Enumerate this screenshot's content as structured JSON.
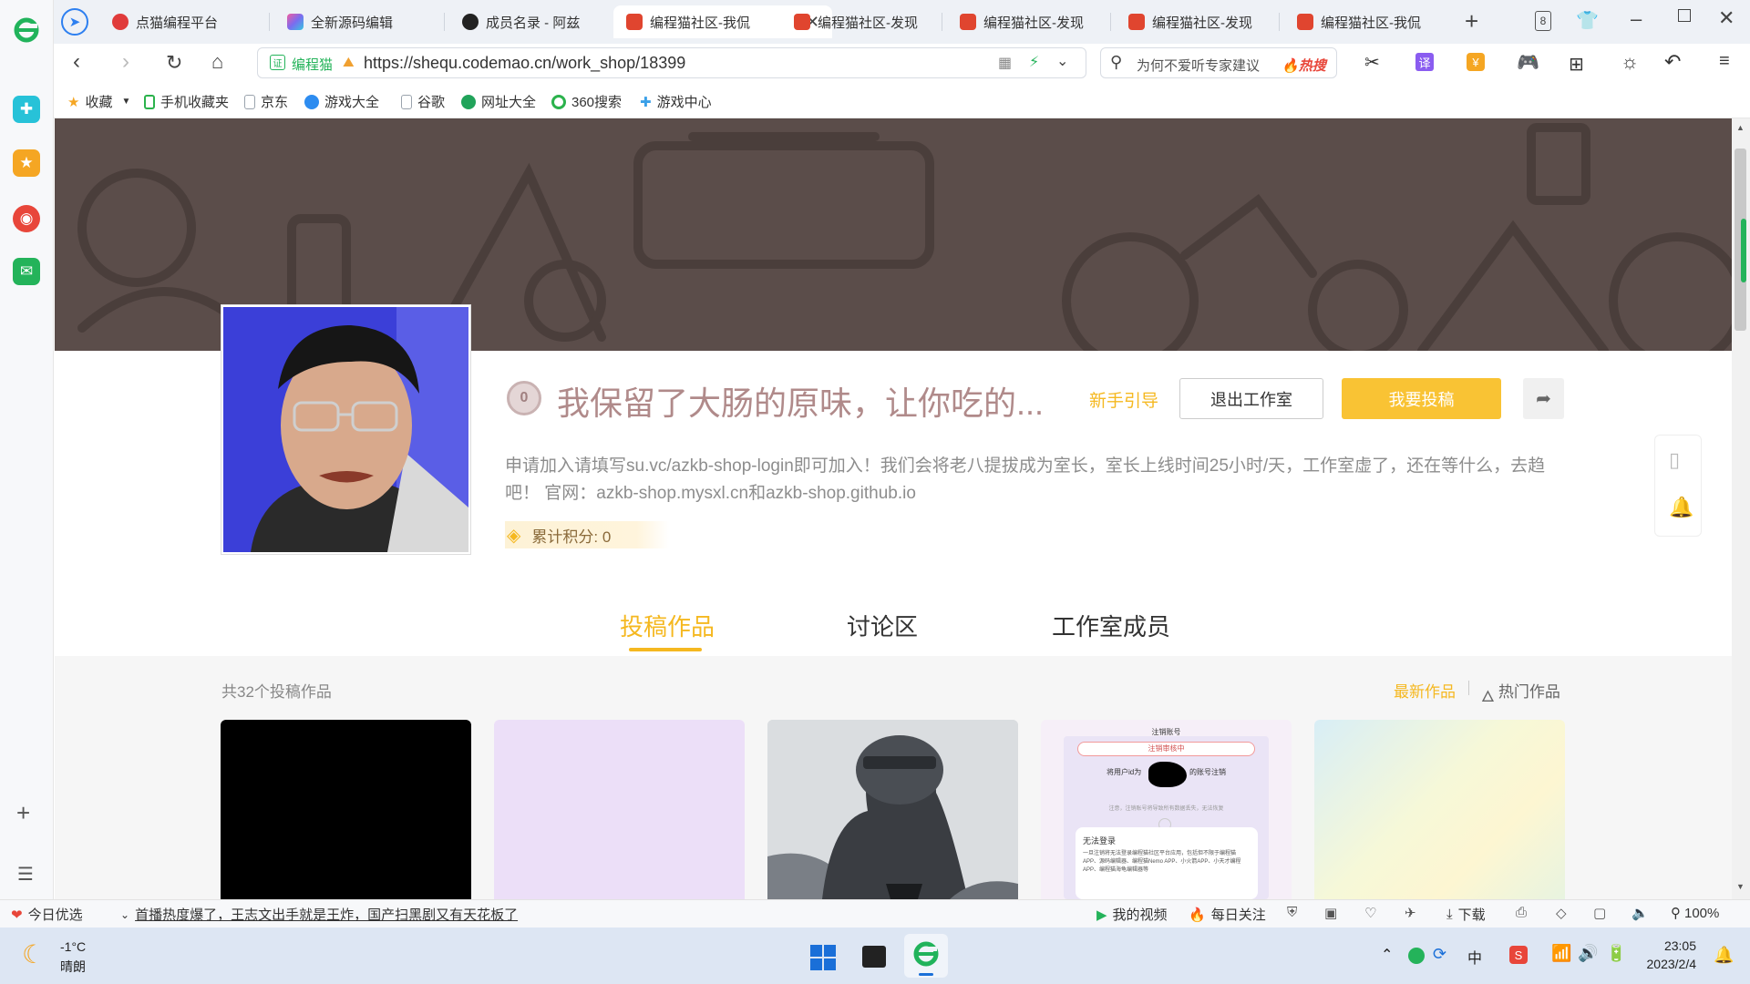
{
  "browser": {
    "tabs": [
      {
        "label": "点猫编程平台",
        "color": "#e03b3b"
      },
      {
        "label": "全新源码编辑",
        "color": "#7a6cf0"
      },
      {
        "label": "成员名录 - 阿兹",
        "color": "#222222"
      },
      {
        "label": "编程猫社区-我侃",
        "color": "#e0452f"
      },
      {
        "label": "编程猫社区-发现",
        "color": "#e0452f"
      },
      {
        "label": "编程猫社区-发现",
        "color": "#e0452f"
      },
      {
        "label": "编程猫社区-发现",
        "color": "#e0452f"
      },
      {
        "label": "编程猫社区-我侃",
        "color": "#e0452f"
      }
    ],
    "tab_count": "8",
    "site_badge": "编程猫",
    "url": "https://shequ.codemao.cn/work_shop/18399",
    "search_placeholder": "为何不爱听专家建议",
    "hot_label": "热搜",
    "translate_label": "译",
    "bookmarks": [
      {
        "label": "收藏",
        "color": "#f5a623"
      },
      {
        "label": "手机收藏夹",
        "color": "#2bb24c"
      },
      {
        "label": "京东",
        "color": "#9aa3ad"
      },
      {
        "label": "游戏大全",
        "color": "#2d8cf0"
      },
      {
        "label": "谷歌",
        "color": "#9aa3ad"
      },
      {
        "label": "网址大全",
        "color": "#21a35a"
      },
      {
        "label": "360搜索",
        "color": "#2bb24c"
      },
      {
        "label": "游戏中心",
        "color": "#3aa0e8"
      }
    ]
  },
  "studio": {
    "level_badge": "0",
    "name": "我保留了大肠的原味，让你吃的...",
    "guide_link": "新手引导",
    "leave_button": "退出工作室",
    "submit_button": "我要投稿",
    "description": "申请加入请填写su.vc/azkb-shop-login即可加入！我们会将老八提拔成为室长，室长上线时间25小时/天，工作室虚了，还在等什么，去趋吧！ 官网：azkb-shop.mysxl.cn和azkb-shop.github.io",
    "points_label": "累计积分: 0",
    "tabs": [
      "投稿作品",
      "讨论区",
      "工作室成员"
    ],
    "active_tab": 0,
    "works_count": "共32个投稿作品",
    "sort_latest": "最新作品",
    "sort_hot": "热门作品",
    "card4": {
      "heading": "注销账号",
      "pill": "注销审核中",
      "line": "将用户id为",
      "line_tail": "的账号注销",
      "small": "注意，注销账号将导致所有数据丢失，无法恢复",
      "box_title": "无法登录",
      "box_text": "一旦注销将无法登录编程猫社区平台应用，包括但不限于编程猫APP、源码编辑器、编程猫Nemo APP、小火箭APP、小天才编程APP、编程猫海龟编辑器等"
    }
  },
  "statusbar": {
    "left_label": "今日优选",
    "news": "首播热度爆了，王志文出手就是王炸，国产扫黑剧又有天花板了",
    "my_video": "我的视频",
    "daily_follow": "每日关注",
    "download": "下载",
    "zoom": "100%"
  },
  "taskbar": {
    "temperature": "-1°C",
    "weather": "晴朗",
    "time": "23:05",
    "date": "2023/2/4",
    "ime": "中"
  },
  "colors": {
    "accent": "#f5b820",
    "banner": "#5b4d4a",
    "studio_name": "#b08a8a"
  }
}
